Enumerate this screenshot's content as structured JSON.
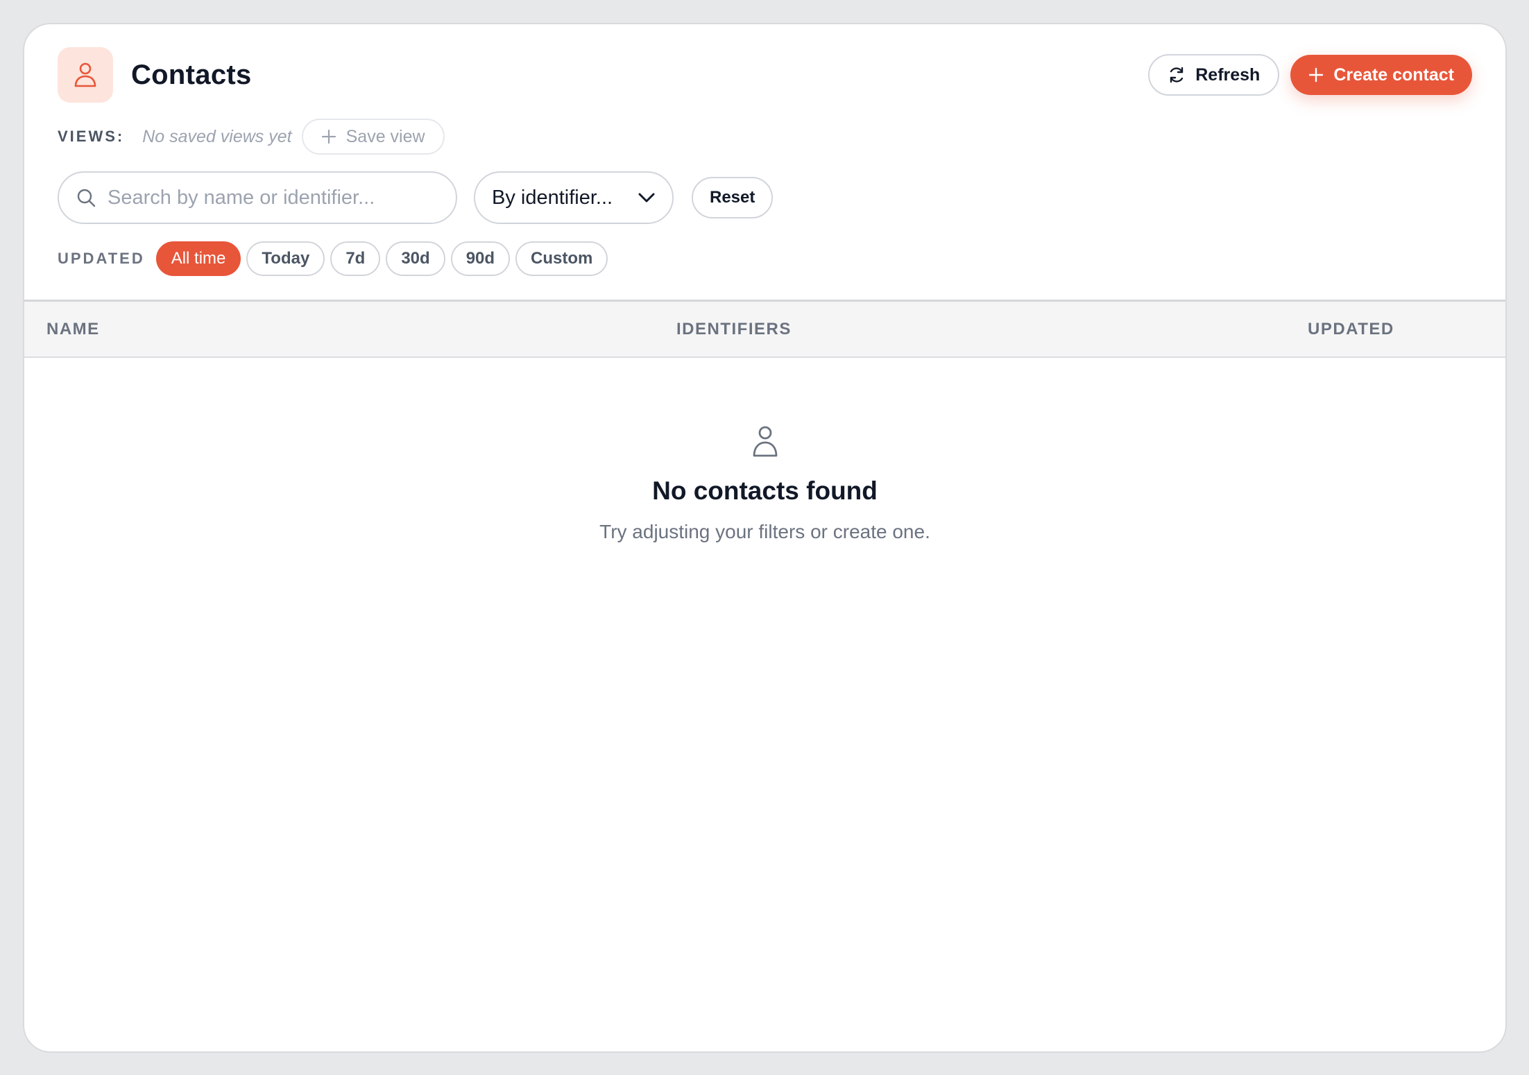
{
  "header": {
    "title": "Contacts",
    "logo_icon": "user-icon",
    "refresh_label": "Refresh",
    "create_label": "Create contact"
  },
  "views": {
    "label": "VIEWS:",
    "empty_text": "No saved views yet",
    "save_label": "Save view"
  },
  "filters": {
    "search_placeholder": "Search by name or identifier...",
    "search_value": "",
    "select_value": "By identifier...",
    "reset_label": "Reset"
  },
  "updated": {
    "label": "UPDATED",
    "chips": [
      "All time",
      "Today",
      "7d",
      "30d",
      "90d",
      "Custom"
    ],
    "active": "All time"
  },
  "table": {
    "columns": [
      "NAME",
      "IDENTIFIERS",
      "UPDATED"
    ]
  },
  "empty_state": {
    "icon": "user-icon",
    "title": "No contacts found",
    "subtitle": "Try adjusting your filters or create one."
  },
  "colors": {
    "accent": "#e8563a",
    "accent_soft": "#fde4dc",
    "background": "#e7e8ea"
  }
}
